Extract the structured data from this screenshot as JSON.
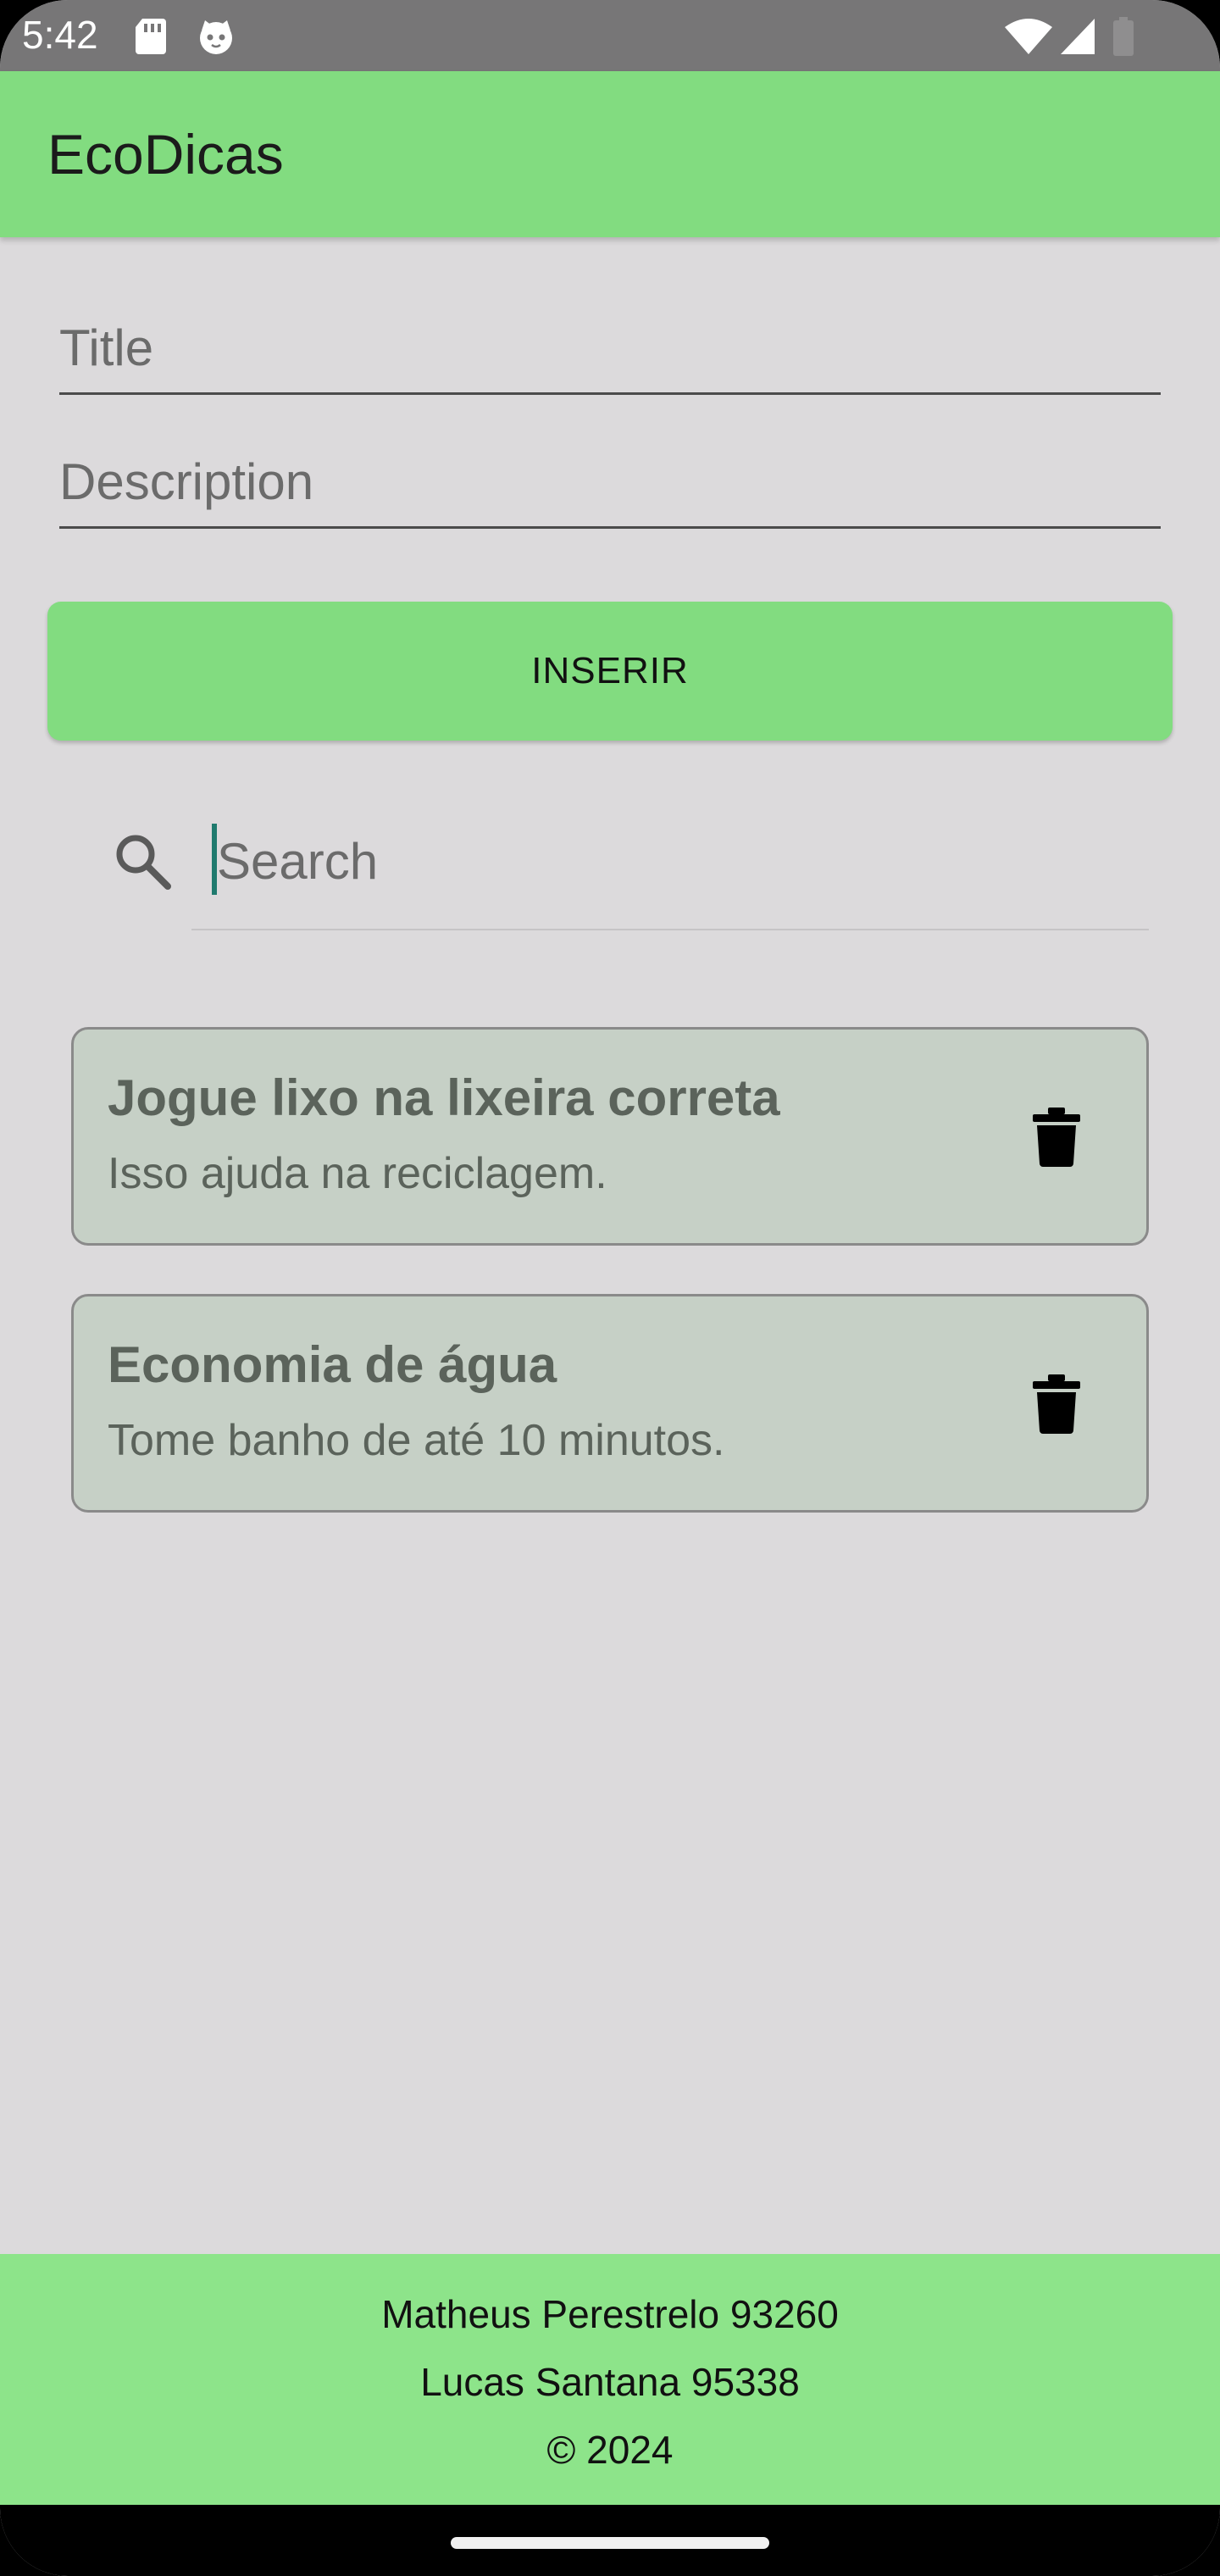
{
  "status_bar": {
    "time": "5:42",
    "icons": [
      "sd-card-icon",
      "cat-icon",
      "wifi-icon",
      "signal-icon",
      "battery-icon"
    ]
  },
  "app_bar": {
    "title": "EcoDicas"
  },
  "form": {
    "title_placeholder": "Title",
    "title_value": "",
    "description_placeholder": "Description",
    "description_value": "",
    "insert_label": "INSERIR"
  },
  "search": {
    "placeholder": "Search",
    "value": "",
    "icon": "search-icon"
  },
  "tips": [
    {
      "title": "Jogue lixo na lixeira correta",
      "description": "Isso ajuda na reciclagem."
    },
    {
      "title": "Economia de água",
      "description": "Tome banho de até 10 minutos."
    }
  ],
  "footer": {
    "line1": "Matheus Perestrelo 93260",
    "line2": "Lucas Santana 95338",
    "line3": "© 2024"
  },
  "colors": {
    "accent_green": "#82dc80",
    "footer_green": "#8de48a",
    "background": "#dcdadc",
    "card_bg": "#c6d0c6"
  }
}
